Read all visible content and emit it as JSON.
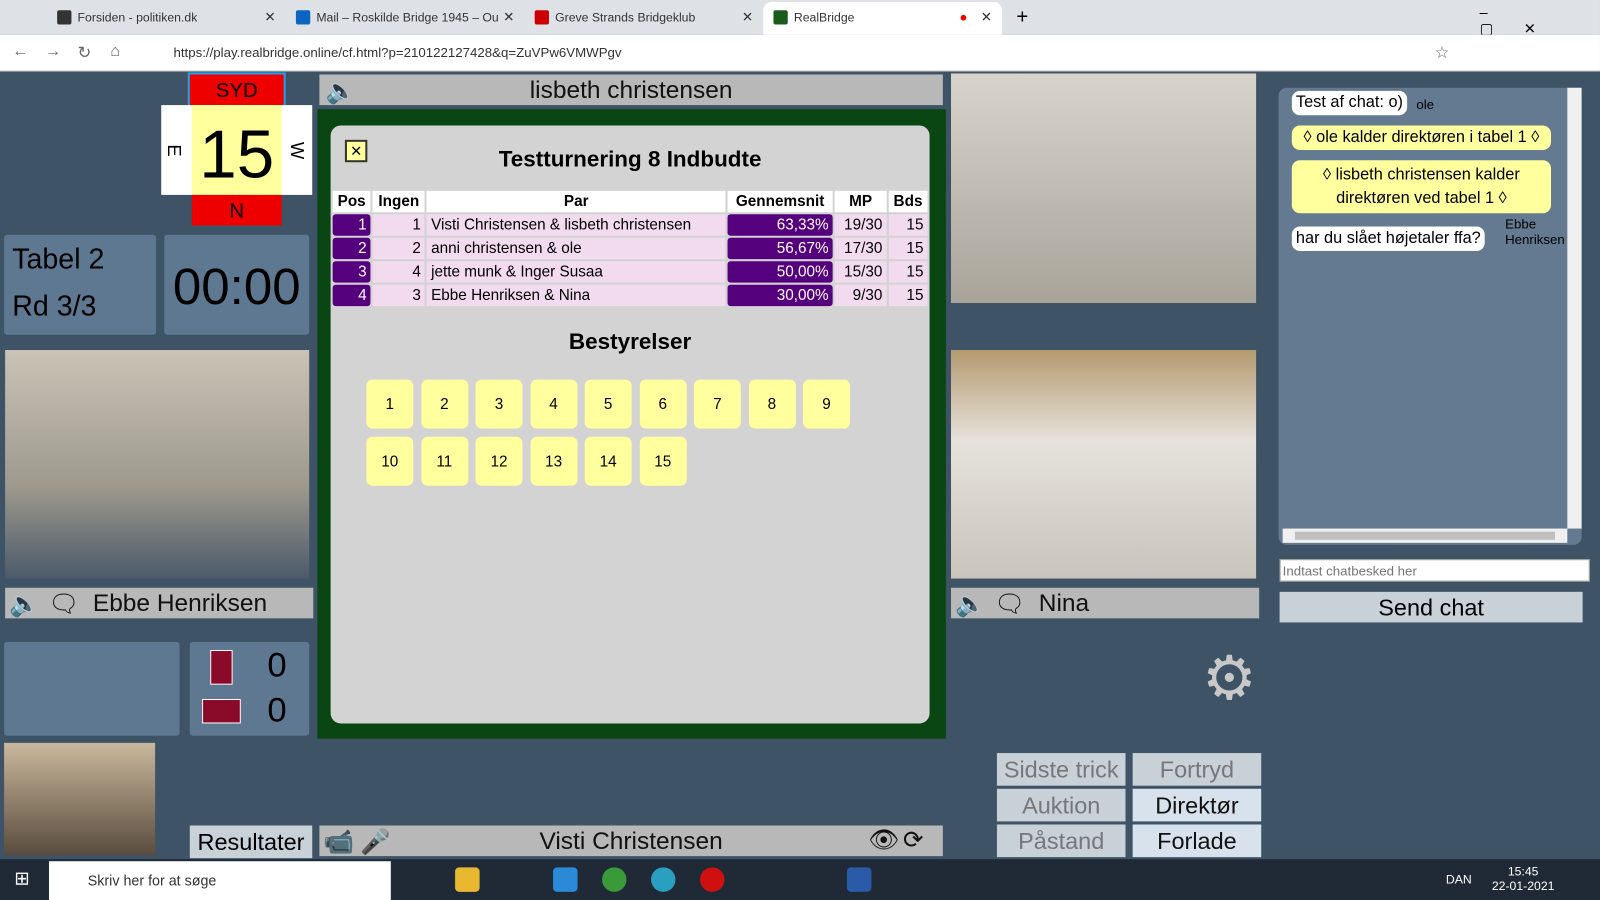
{
  "browser": {
    "tabs": [
      {
        "label": "Forsiden - politiken.dk"
      },
      {
        "label": "Mail – Roskilde Bridge 1945 – Ou"
      },
      {
        "label": "Greve Strands Bridgeklub"
      },
      {
        "label": "RealBridge"
      }
    ],
    "url": "https://play.realbridge.online/cf.html?p=210122127428&q=ZuVPw6VMWPgv"
  },
  "compass": {
    "top": "SYD",
    "bottom": "N",
    "left": "E",
    "right": "W",
    "board": "15"
  },
  "table_info": {
    "table": "Tabel 2",
    "round": "Rd 3/3",
    "clock": "00:00"
  },
  "players": {
    "north": "lisbeth christensen",
    "west": "Ebbe Henriksen",
    "east": "Nina",
    "south": "Visti Christensen"
  },
  "score": {
    "ns": "0",
    "ew": "0"
  },
  "results": {
    "title": "Testturnering 8 Indbudte",
    "columns": [
      "Pos",
      "Ingen",
      "Par",
      "Gennemsnit",
      "MP",
      "Bds"
    ],
    "rows": [
      [
        "1",
        "1",
        "Visti Christensen & lisbeth christensen",
        "63,33%",
        "19/30",
        "15"
      ],
      [
        "2",
        "2",
        "anni christensen & ole",
        "56,67%",
        "17/30",
        "15"
      ],
      [
        "3",
        "4",
        "jette munk & Inger Susaa",
        "50,00%",
        "15/30",
        "15"
      ],
      [
        "4",
        "3",
        "Ebbe Henriksen & Nina",
        "30,00%",
        "9/30",
        "15"
      ]
    ],
    "boards_title": "Bestyrelser",
    "boards": [
      "1",
      "2",
      "3",
      "4",
      "5",
      "6",
      "7",
      "8",
      "9",
      "10",
      "11",
      "12",
      "13",
      "14",
      "15"
    ],
    "accent": "#55007d"
  },
  "buttons": {
    "results": "Resultater",
    "last_trick": "Sidste trick",
    "auction": "Auktion",
    "claim": "Påstand",
    "undo": "Fortryd",
    "director": "Direktør",
    "leave": "Forlade",
    "send": "Send chat"
  },
  "chat": {
    "messages": [
      {
        "text": "Test af chat: o)",
        "sender": "ole"
      },
      {
        "text": "◊ ole kalder direktøren i tabel 1 ◊"
      },
      {
        "text": "◊ lisbeth christensen kalder direktøren ved tabel 1 ◊"
      },
      {
        "text": "har du slået højetaler ffa?",
        "sender": "Ebbe Henriksen"
      }
    ],
    "placeholder": "Indtast chatbesked her"
  },
  "taskbar": {
    "search": "Skriv her for at søge",
    "lang": "DAN",
    "time": "15:45",
    "date": "22-01-2021"
  }
}
